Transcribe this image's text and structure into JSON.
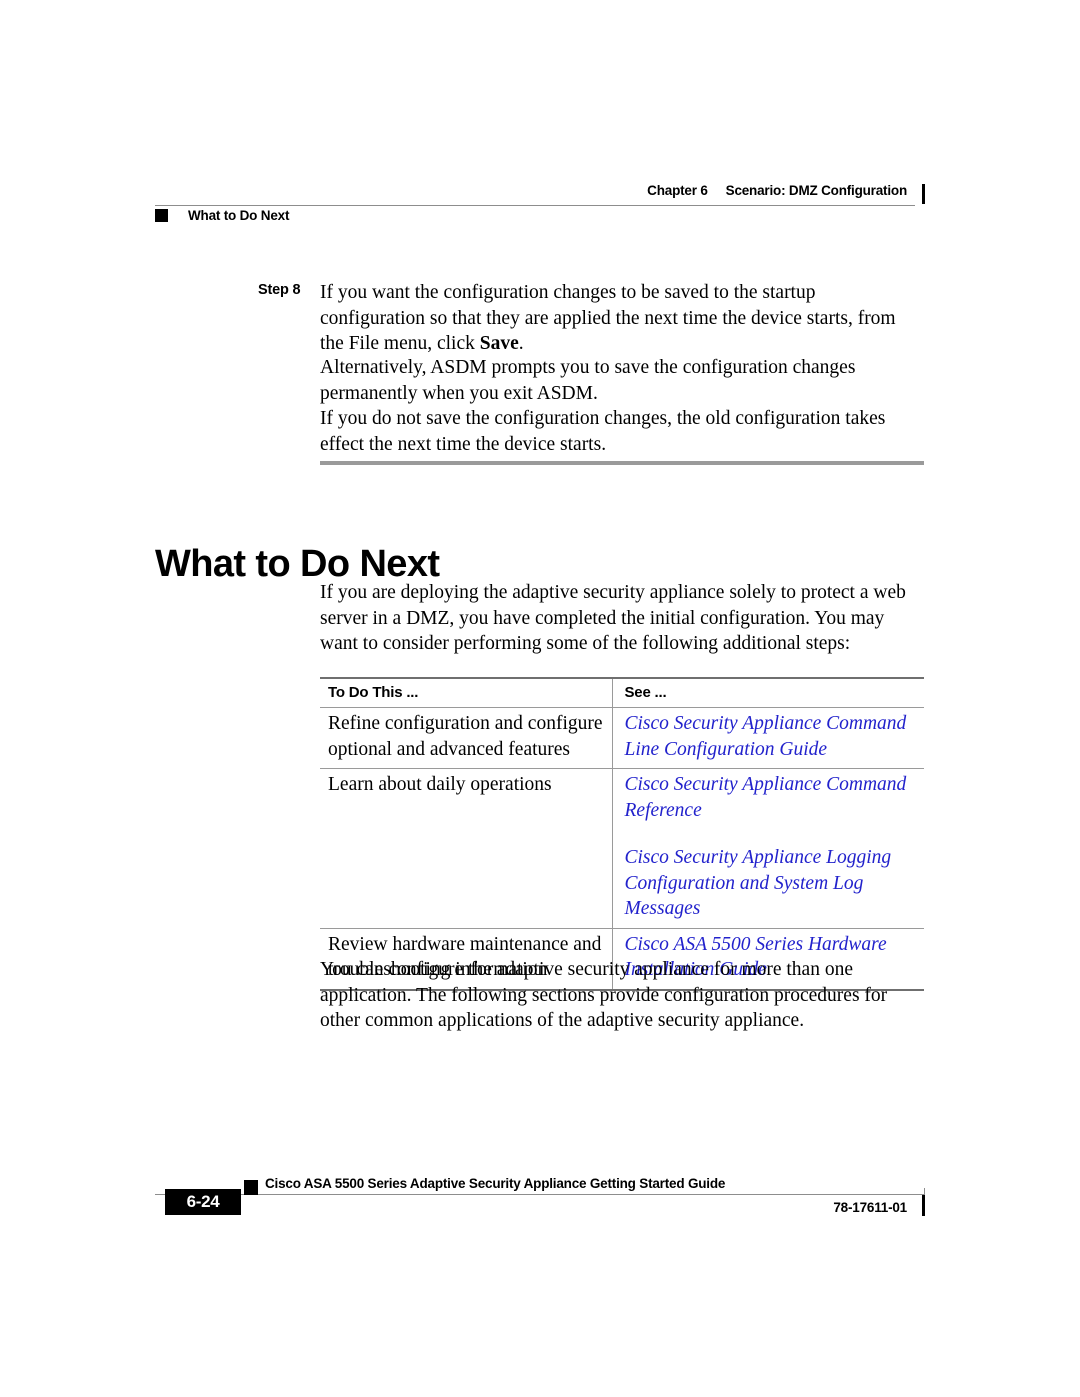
{
  "header": {
    "chapter": "Chapter 6",
    "chapter_title": "Scenario: DMZ Configuration",
    "running_section": "What to Do Next"
  },
  "step": {
    "label": "Step 8",
    "text_part1": "If you want the configuration changes to be saved to the startup configuration so that they are applied the next time the device starts, from the File menu, click ",
    "bold_term": "Save",
    "text_part2": "."
  },
  "paragraphs": {
    "alternatively": "Alternatively, ASDM prompts you to save the configuration changes permanently when you exit ASDM.",
    "not_saved": "If you do not save the configuration changes, the old configuration takes effect the next time the device starts.",
    "intro": "If you are deploying the adaptive security appliance solely to protect a web server in a DMZ, you have completed the initial configuration. You may want to consider performing some of the following additional steps:",
    "closing": "You can configure the adaptive security appliance for more than one application. The following sections provide configuration procedures for other common applications of the adaptive security appliance."
  },
  "section": {
    "heading": "What to Do Next"
  },
  "table": {
    "headers": {
      "col1": "To Do This ...",
      "col2": "See ..."
    },
    "rows": [
      {
        "task": "Refine configuration and configure optional and advanced features",
        "refs": [
          "Cisco Security Appliance Command Line Configuration Guide"
        ]
      },
      {
        "task": "Learn about daily operations",
        "refs": [
          "Cisco Security Appliance Command Reference",
          "Cisco Security Appliance Logging Configuration and System Log Messages"
        ]
      },
      {
        "task": "Review hardware maintenance and troubleshooting information",
        "refs": [
          "Cisco ASA 5500 Series Hardware Installation Guide"
        ]
      }
    ],
    "link_color": "#2222cc"
  },
  "footer": {
    "page_number": "6-24",
    "guide_title": "Cisco ASA 5500 Series Adaptive Security Appliance Getting Started Guide",
    "doc_number": "78-17611-01"
  }
}
